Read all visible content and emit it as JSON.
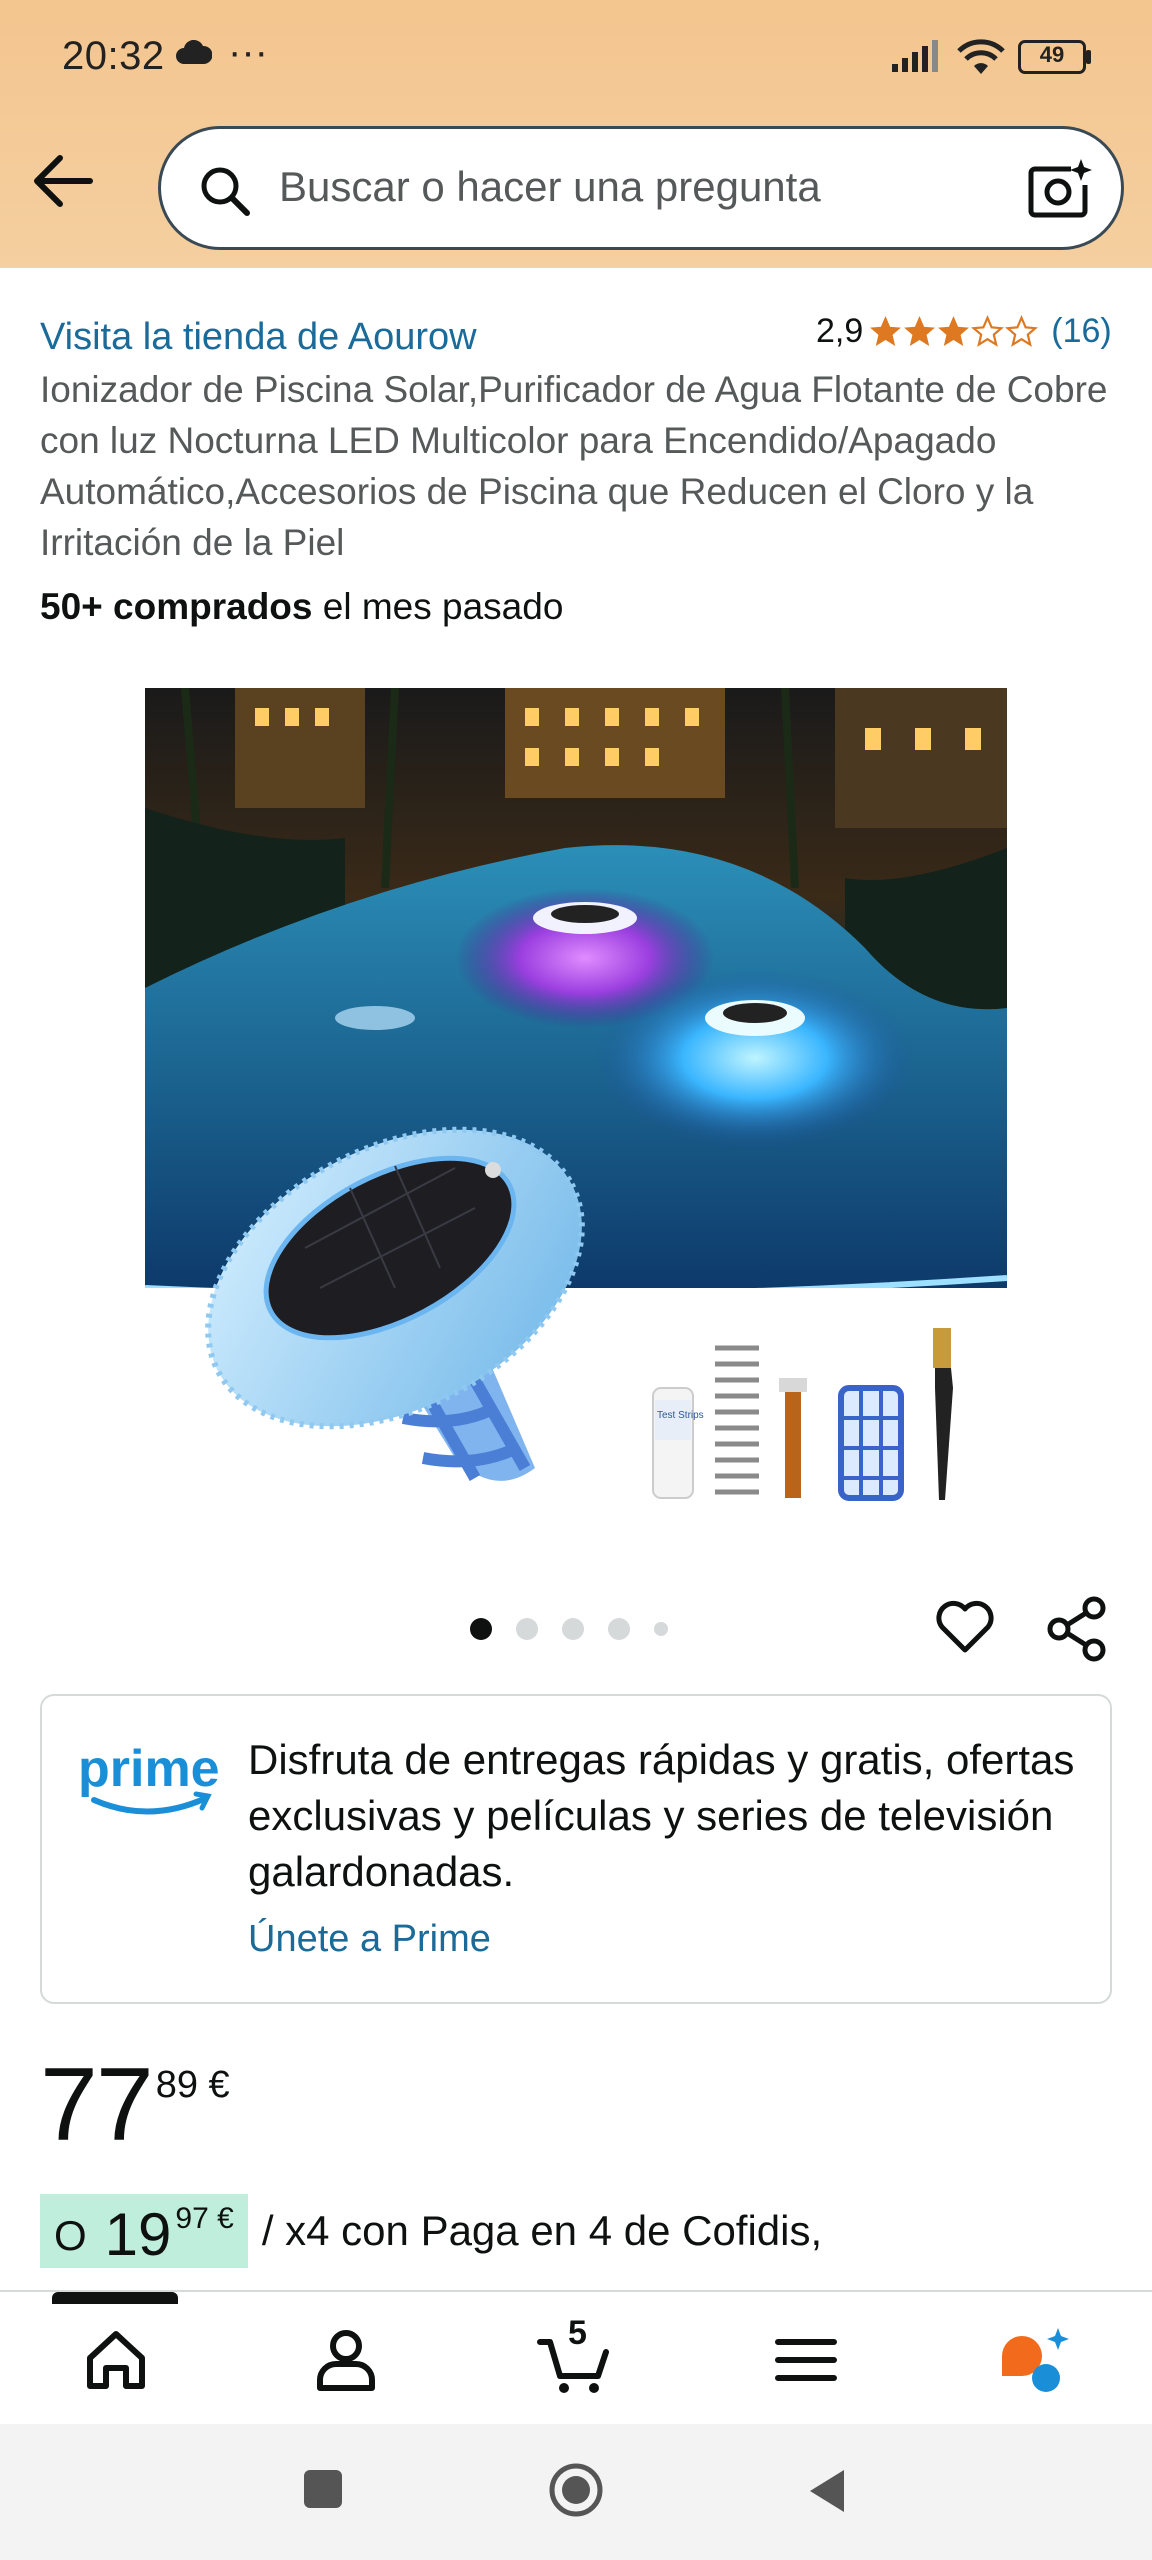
{
  "status_bar": {
    "time": "20:32",
    "more": "···",
    "battery": "49"
  },
  "search": {
    "placeholder": "Buscar o hacer una pregunta"
  },
  "product": {
    "store_link": "Visita la tienda de Aourow",
    "rating_value": "2,9",
    "rating_stars": 2.9,
    "rating_count": "(16)",
    "title": "Ionizador de Piscina Solar,Purificador de Agua Flotante de Cobre con luz Nocturna LED Multicolor para Encendido/Apagado Automático,Accesorios de Piscina que Reducen el Cloro y la Irritación de la Piel",
    "bought_bold": "50+ comprados",
    "bought_rest": " el mes pasado",
    "image_count": 5,
    "active_image": 1,
    "test_strip_label": "Test Strips"
  },
  "prime": {
    "logo": "prime",
    "message": "Disfruta de entregas rápidas y gratis, ofertas exclusivas y películas y series de televisión galardonadas.",
    "join_link": "Únete a Prime"
  },
  "price": {
    "whole": "77",
    "fraction": "89 €"
  },
  "installment": {
    "prefix": "O",
    "whole": "19",
    "fraction": "97 €",
    "rest": "/ x4 con Paga en 4 de Cofidis,"
  },
  "bottom_nav": {
    "items": [
      "home-icon",
      "account-icon",
      "cart-icon",
      "menu-icon",
      "rufus-icon"
    ],
    "cart_count": "5"
  },
  "colors": {
    "link": "#1a6a9a",
    "star": "#de7921",
    "header": "#f3c58f",
    "installment_bg": "#bfeedd"
  }
}
